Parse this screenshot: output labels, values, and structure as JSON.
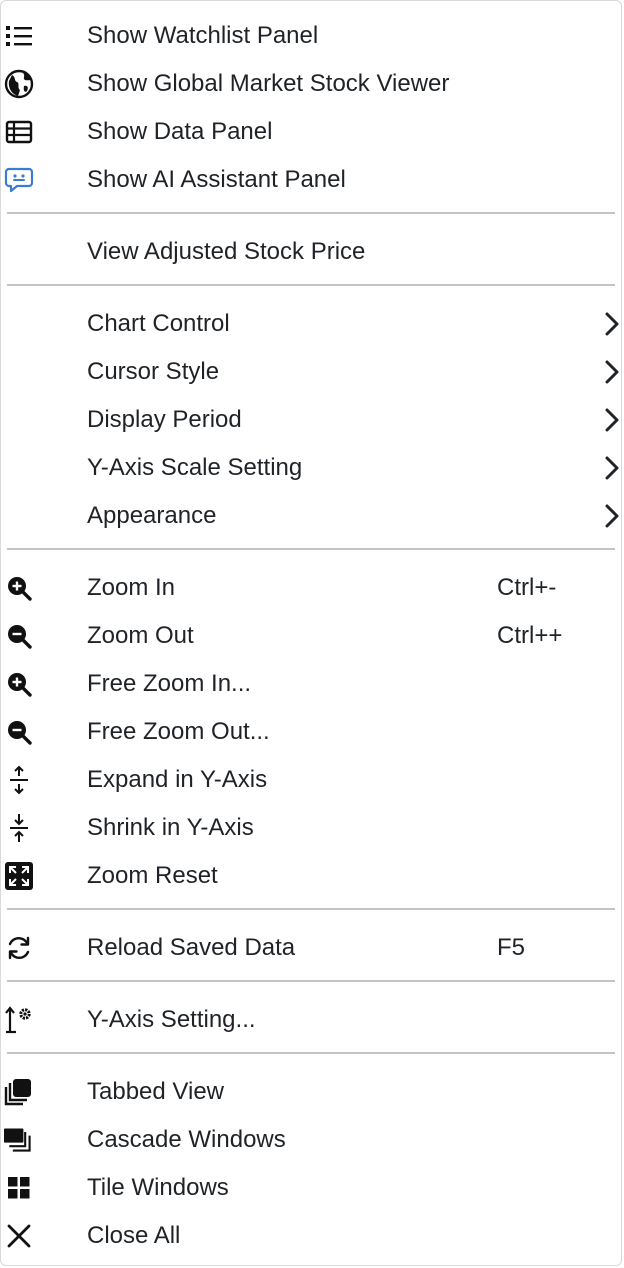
{
  "menu": {
    "items": [
      {
        "label": "Show Watchlist Panel",
        "icon": "list-icon"
      },
      {
        "label": "Show Global Market Stock Viewer",
        "icon": "globe-icon"
      },
      {
        "label": "Show Data Panel",
        "icon": "table-icon"
      },
      {
        "label": "Show AI Assistant Panel",
        "icon": "ai-chat-icon",
        "icon_color": "#3b7bd0"
      },
      {
        "label": "View Adjusted Stock Price"
      },
      {
        "label": "Chart Control",
        "submenu": true
      },
      {
        "label": "Cursor Style",
        "submenu": true
      },
      {
        "label": "Display Period",
        "submenu": true
      },
      {
        "label": "Y-Axis Scale Setting",
        "submenu": true
      },
      {
        "label": "Appearance",
        "submenu": true
      },
      {
        "label": "Zoom In",
        "icon": "zoom-in-icon",
        "shortcut": "Ctrl+-"
      },
      {
        "label": "Zoom Out",
        "icon": "zoom-out-icon",
        "shortcut": "Ctrl++"
      },
      {
        "label": "Free Zoom In...",
        "icon": "zoom-in-icon"
      },
      {
        "label": "Free Zoom Out...",
        "icon": "zoom-out-icon"
      },
      {
        "label": "Expand in Y-Axis",
        "icon": "expand-vertical-icon"
      },
      {
        "label": "Shrink in Y-Axis",
        "icon": "shrink-vertical-icon"
      },
      {
        "label": "Zoom Reset",
        "icon": "zoom-reset-icon"
      },
      {
        "label": "Reload Saved Data",
        "icon": "reload-icon",
        "shortcut": "F5"
      },
      {
        "label": "Y-Axis Setting...",
        "icon": "axis-settings-icon"
      },
      {
        "label": "Tabbed View",
        "icon": "tabbed-view-icon"
      },
      {
        "label": "Cascade Windows",
        "icon": "cascade-windows-icon"
      },
      {
        "label": "Tile Windows",
        "icon": "tile-windows-icon"
      },
      {
        "label": "Close All",
        "icon": "close-icon"
      }
    ]
  }
}
